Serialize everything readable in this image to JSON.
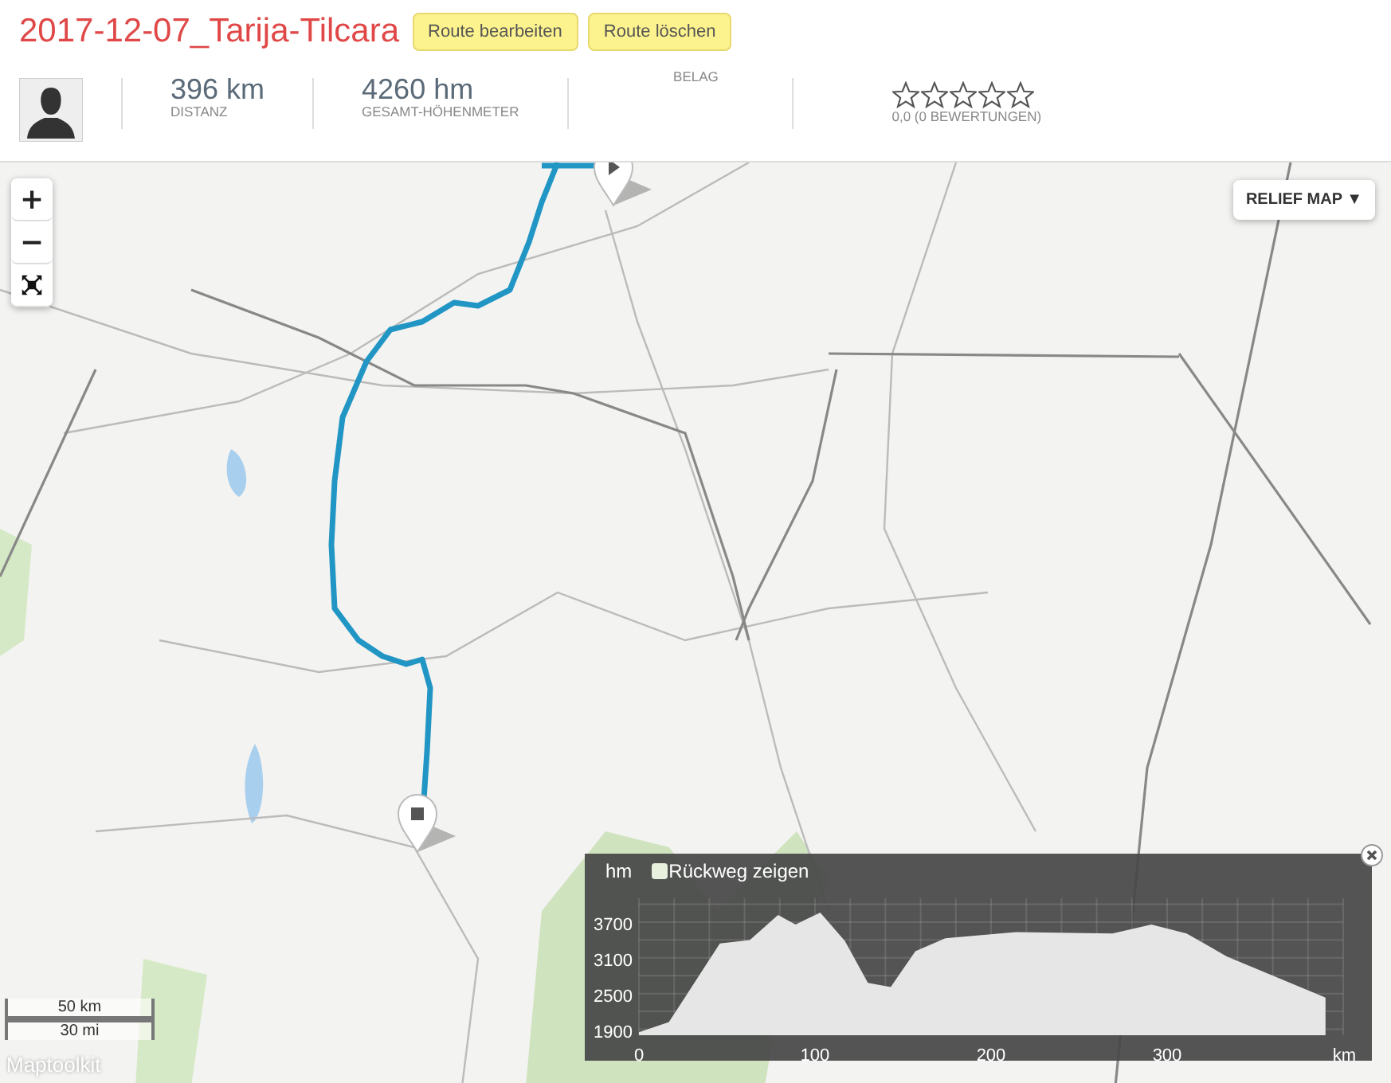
{
  "route": {
    "title": "2017-12-07_Tarija-Tilcara",
    "buttons": [
      "Route bearbeiten",
      "Route löschen"
    ]
  },
  "stats": [
    {
      "kind": "value",
      "value": "396 km",
      "label": "DISTANZ"
    },
    {
      "kind": "value",
      "value": "4260 hm",
      "label": "GESAMT-HÖHENMETER"
    },
    {
      "kind": "label",
      "label": "BELAG"
    },
    {
      "kind": "rating",
      "stars": 0,
      "label": "0,0 (0 BEWERTUNGEN)"
    }
  ],
  "map": {
    "zoom_controls": [
      "+",
      "−"
    ],
    "layer_button": "RELIEF MAP ▼",
    "scale": [
      "50 km",
      "30 mi"
    ],
    "attribution": "Maptoolkit"
  },
  "profile": {
    "checkbox": {
      "label": "Rückweg zeigen",
      "checked": false
    },
    "chart_data": {
      "type": "area",
      "xlabel": "km",
      "ylabel": "hm",
      "x": [
        0,
        17,
        46,
        63,
        79,
        89,
        103,
        117,
        130,
        143,
        157,
        174,
        214,
        269,
        291,
        311,
        334,
        390
      ],
      "grid": true,
      "series": [
        {
          "color": "#e6e6e6",
          "values": [
            1850,
            2020,
            3340,
            3400,
            3820,
            3660,
            3860,
            3380,
            2680,
            2610,
            3210,
            3430,
            3530,
            3510,
            3660,
            3510,
            3120,
            2430
          ]
        }
      ],
      "xlim": [
        0,
        400
      ],
      "ylim": [
        1800,
        4100
      ],
      "xticks": [
        0,
        100,
        200,
        300
      ],
      "yticks": [
        1900,
        2500,
        3100,
        3700
      ]
    }
  }
}
